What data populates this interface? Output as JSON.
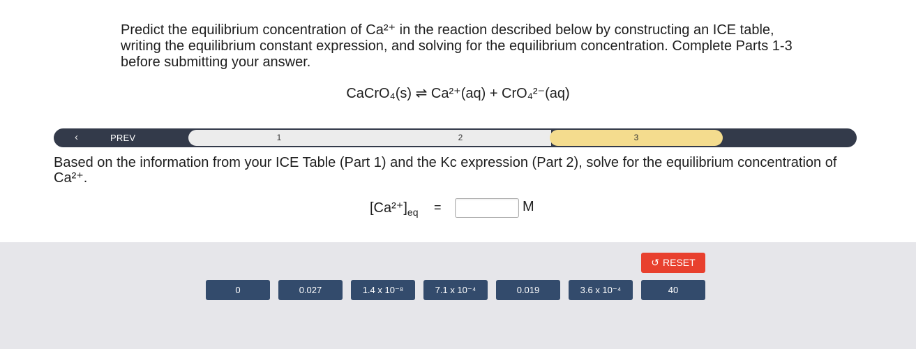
{
  "question": {
    "text": "Predict the equilibrium concentration of Ca²⁺ in the reaction described below by constructing an ICE table, writing the equilibrium constant expression, and solving for the equilibrium concentration. Complete Parts 1-3 before submitting your answer.",
    "equation": "CaCrO₄(s) ⇌ Ca²⁺(aq) + CrO₄²⁻(aq)"
  },
  "progress": {
    "prev_label": "PREV",
    "steps": [
      "1",
      "2",
      "3"
    ],
    "active_step": "3"
  },
  "part": {
    "prompt": "Based on the information from your ICE Table (Part 1) and the  Kc expression (Part 2), solve for the equilibrium concentration of Ca²⁺."
  },
  "answer": {
    "label_main": "[Ca²⁺]",
    "label_sub": "eq",
    "equals": "=",
    "value": "",
    "unit": "M"
  },
  "tray": {
    "reset_label": "RESET",
    "tiles": [
      "0",
      "0.027",
      "1.4 x 10⁻⁸",
      "7.1 x 10⁻⁴",
      "0.019",
      "3.6 x 10⁻⁴",
      "40"
    ]
  },
  "colors": {
    "progress_bg": "#333a4a",
    "active_step": "#f4dc8e",
    "tile_bg": "#334b6c",
    "reset_bg": "#e8402e",
    "tray_bg": "#e6e6ea"
  }
}
